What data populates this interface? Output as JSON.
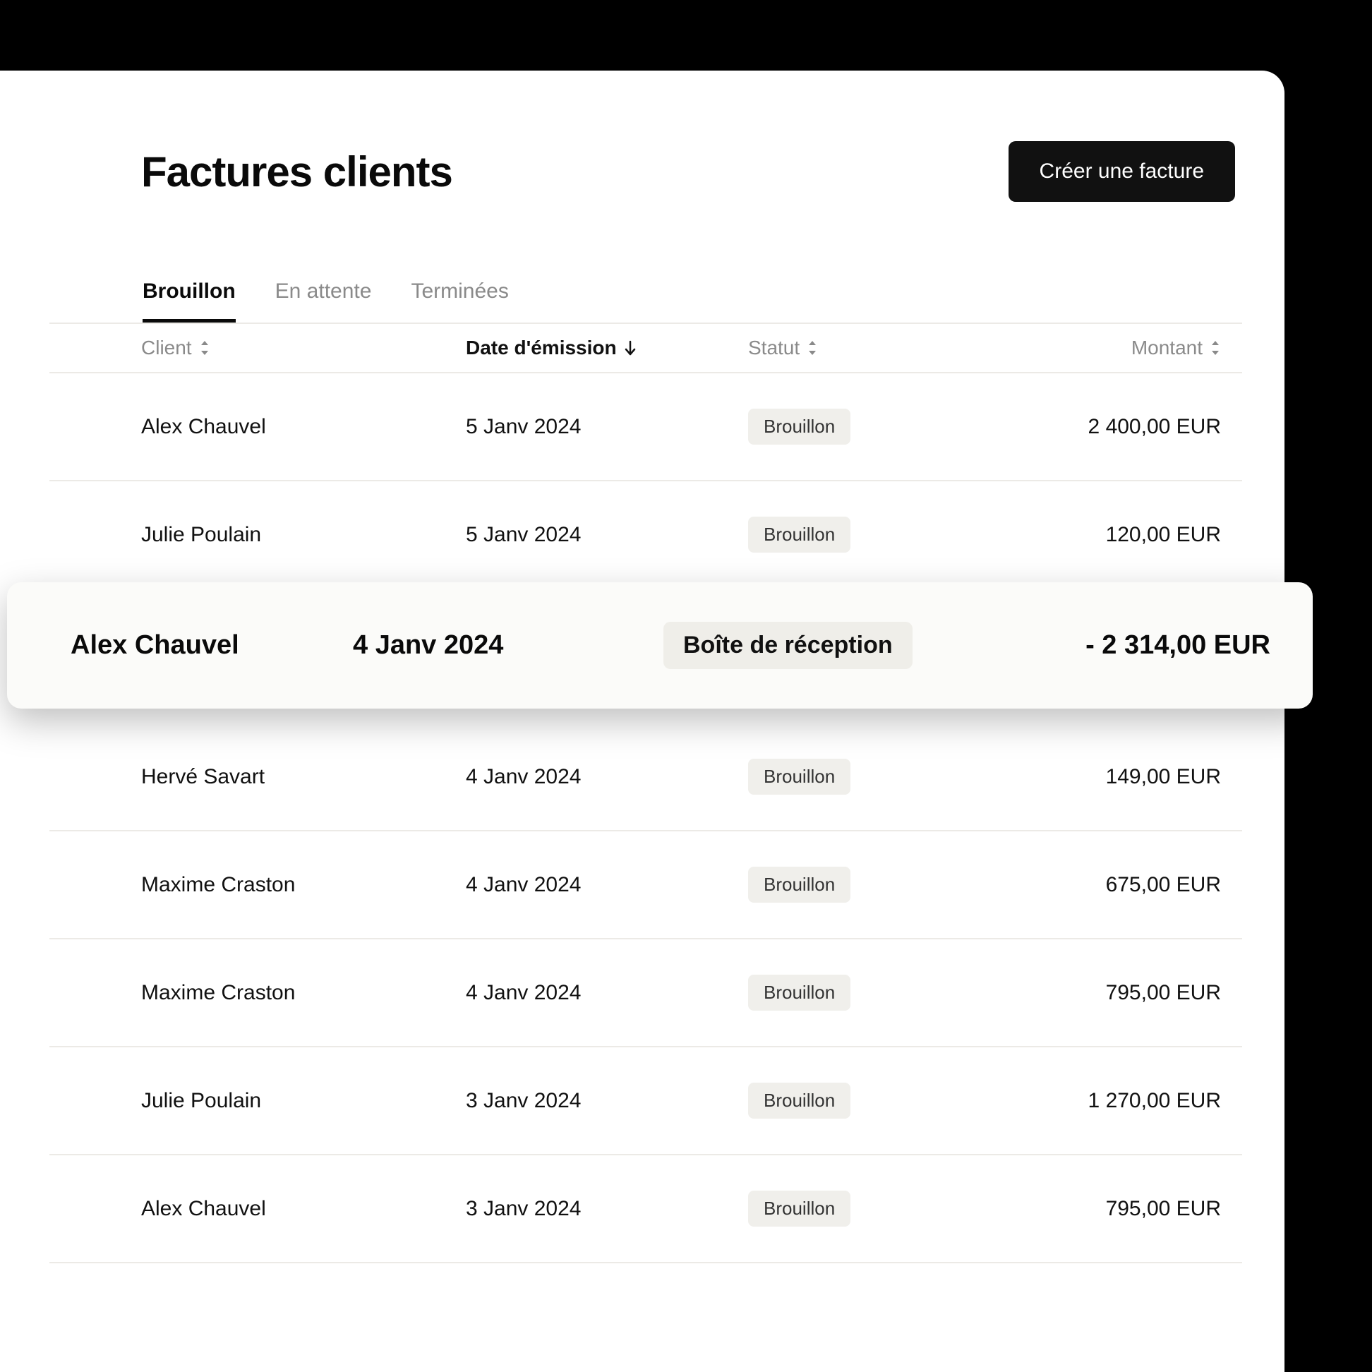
{
  "header": {
    "title": "Factures clients",
    "create_label": "Créer une facture"
  },
  "tabs": [
    {
      "label": "Brouillon",
      "active": true
    },
    {
      "label": "En attente",
      "active": false
    },
    {
      "label": "Terminées",
      "active": false
    }
  ],
  "columns": {
    "client": "Client",
    "date": "Date d'émission",
    "status": "Statut",
    "amount": "Montant"
  },
  "rows": [
    {
      "client": "Alex Chauvel",
      "date": "5 Janv 2024",
      "status": "Brouillon",
      "amount": "2 400,00 EUR"
    },
    {
      "client": "Julie Poulain",
      "date": "5 Janv 2024",
      "status": "Brouillon",
      "amount": "120,00 EUR"
    },
    {
      "client": "Hervé Savart",
      "date": "4 Janv 2024",
      "status": "Brouillon",
      "amount": "149,00 EUR"
    },
    {
      "client": "Maxime Craston",
      "date": "4 Janv 2024",
      "status": "Brouillon",
      "amount": "675,00 EUR"
    },
    {
      "client": "Maxime Craston",
      "date": "4 Janv 2024",
      "status": "Brouillon",
      "amount": "795,00 EUR"
    },
    {
      "client": "Julie Poulain",
      "date": "3 Janv 2024",
      "status": "Brouillon",
      "amount": "1 270,00 EUR"
    },
    {
      "client": "Alex Chauvel",
      "date": "3 Janv 2024",
      "status": "Brouillon",
      "amount": "795,00 EUR"
    }
  ],
  "highlight": {
    "client": "Alex Chauvel",
    "date": "4 Janv 2024",
    "status": "Boîte de réception",
    "amount": "- 2 314,00 EUR",
    "after_row_index": 1
  }
}
